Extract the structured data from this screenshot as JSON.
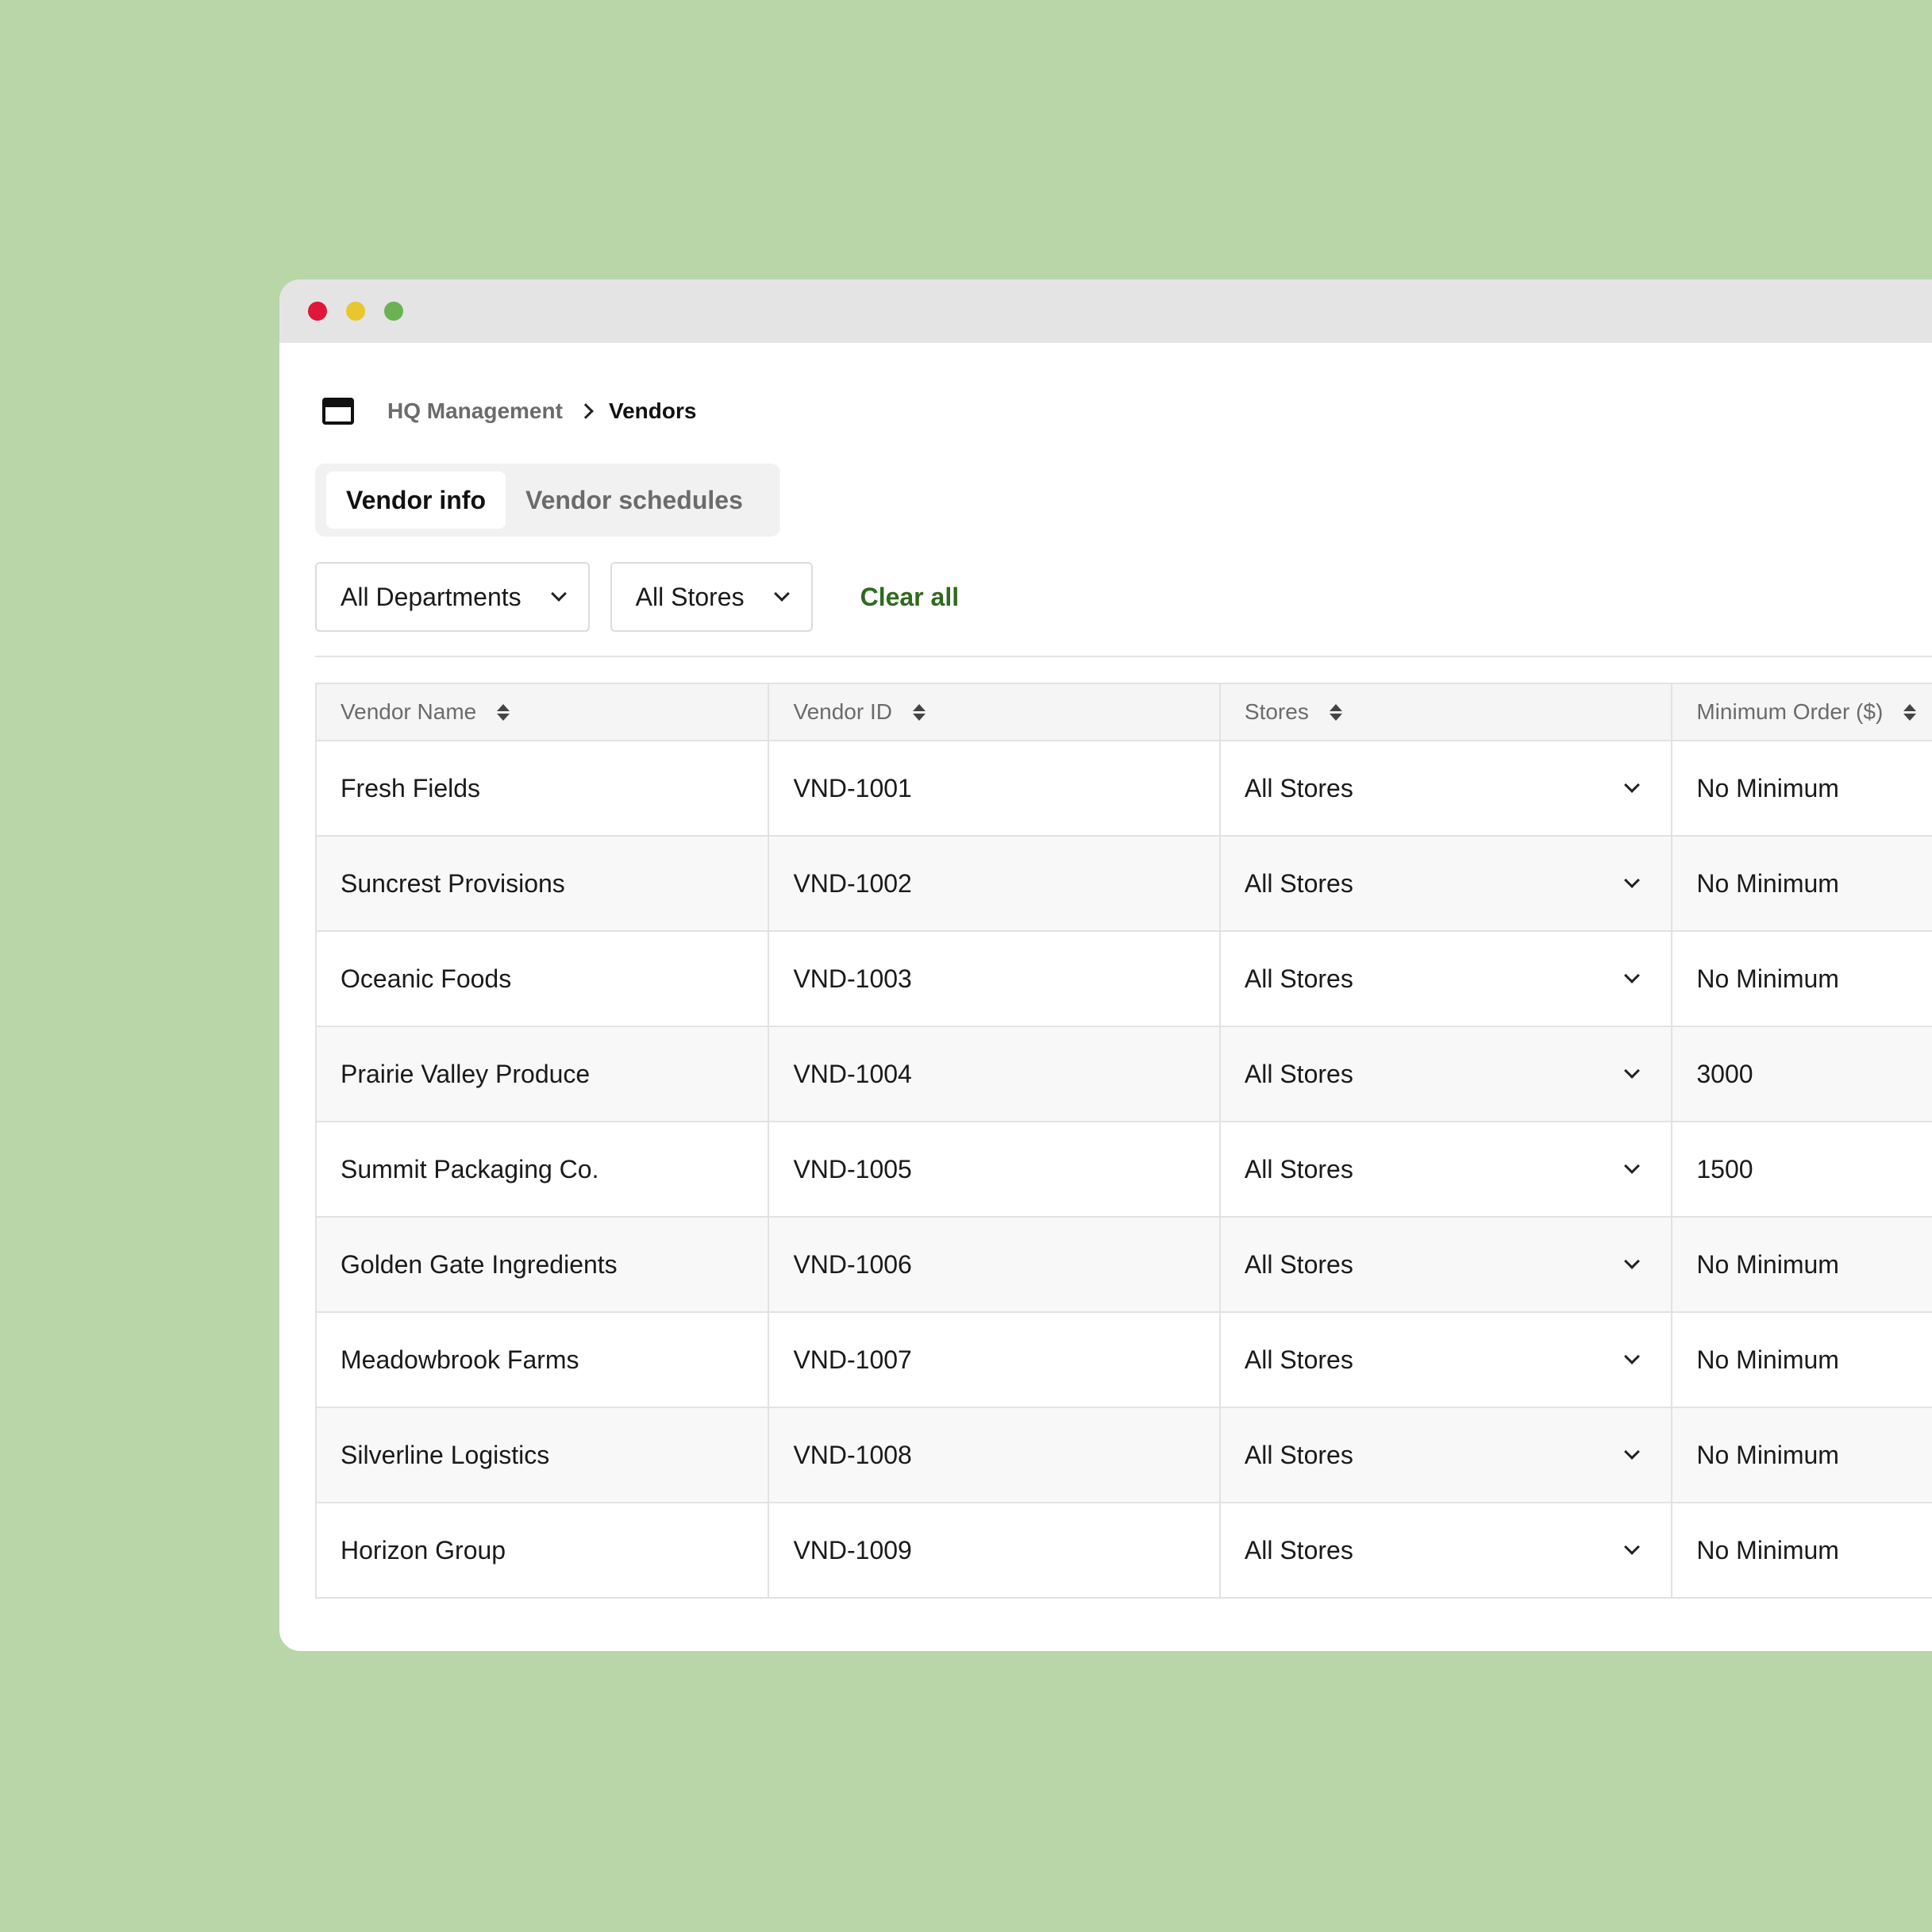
{
  "breadcrumb": {
    "parent": "HQ Management",
    "current": "Vendors"
  },
  "tabs": [
    {
      "label": "Vendor info",
      "active": true
    },
    {
      "label": "Vendor schedules",
      "active": false
    }
  ],
  "filters": {
    "department": "All Departments",
    "store": "All Stores",
    "clear_label": "Clear all"
  },
  "table": {
    "headers": [
      "Vendor Name",
      "Vendor ID",
      "Stores",
      "Minimum Order ($)"
    ],
    "rows": [
      {
        "name": "Fresh Fields",
        "id": "VND-1001",
        "stores": "All Stores",
        "min": "No Minimum"
      },
      {
        "name": "Suncrest Provisions",
        "id": "VND-1002",
        "stores": "All Stores",
        "min": "No Minimum"
      },
      {
        "name": "Oceanic Foods",
        "id": "VND-1003",
        "stores": "All Stores",
        "min": "No Minimum"
      },
      {
        "name": "Prairie Valley Produce",
        "id": "VND-1004",
        "stores": "All Stores",
        "min": "3000"
      },
      {
        "name": "Summit Packaging Co.",
        "id": "VND-1005",
        "stores": "All Stores",
        "min": "1500"
      },
      {
        "name": "Golden Gate Ingredients",
        "id": "VND-1006",
        "stores": "All Stores",
        "min": "No Minimum"
      },
      {
        "name": "Meadowbrook Farms",
        "id": "VND-1007",
        "stores": "All Stores",
        "min": "No Minimum"
      },
      {
        "name": "Silverline Logistics",
        "id": "VND-1008",
        "stores": "All Stores",
        "min": "No Minimum"
      },
      {
        "name": "Horizon Group",
        "id": "VND-1009",
        "stores": "All Stores",
        "min": "No Minimum"
      }
    ]
  },
  "colors": {
    "background": "#b8d6a8",
    "accent": "#2f6a1f",
    "close": "#e0163a",
    "minimize": "#e8c62e",
    "maximize": "#6ab252"
  }
}
